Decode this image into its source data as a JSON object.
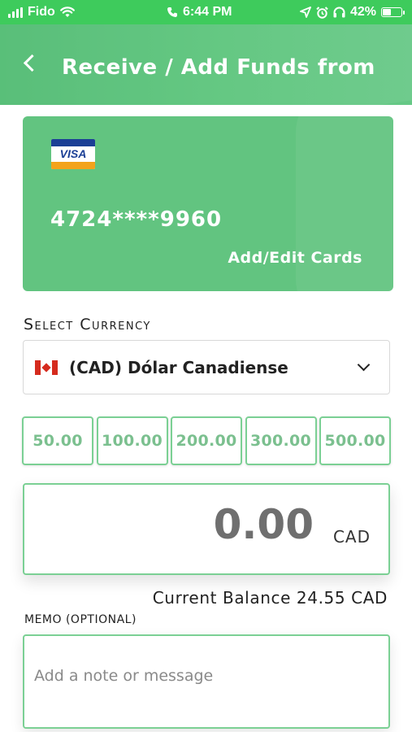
{
  "status_bar": {
    "carrier": "Fido",
    "time": "6:44 PM",
    "battery": "42%",
    "battery_level": 0.42
  },
  "header": {
    "title": "Receive / Add Funds from"
  },
  "card": {
    "brand": "VISA",
    "number": "4724****9960",
    "edit_label": "Add/Edit Cards"
  },
  "currency": {
    "section_label": "Select Currency",
    "selected": "(CAD) Dólar Canadiense"
  },
  "amount_presets": [
    "50.00",
    "100.00",
    "200.00",
    "300.00",
    "500.00"
  ],
  "amount": {
    "value": "0.00",
    "currency": "CAD"
  },
  "balance": "Current Balance 24.55 CAD",
  "memo": {
    "label": "MEMO (OPTIONAL)",
    "placeholder": "Add a note or message"
  },
  "colors": {
    "status_bar": "#3ecb5c",
    "header": "#5cc57c",
    "card": "#62c480",
    "accent_border": "#7bd094",
    "preset_text": "#7bc08f"
  }
}
